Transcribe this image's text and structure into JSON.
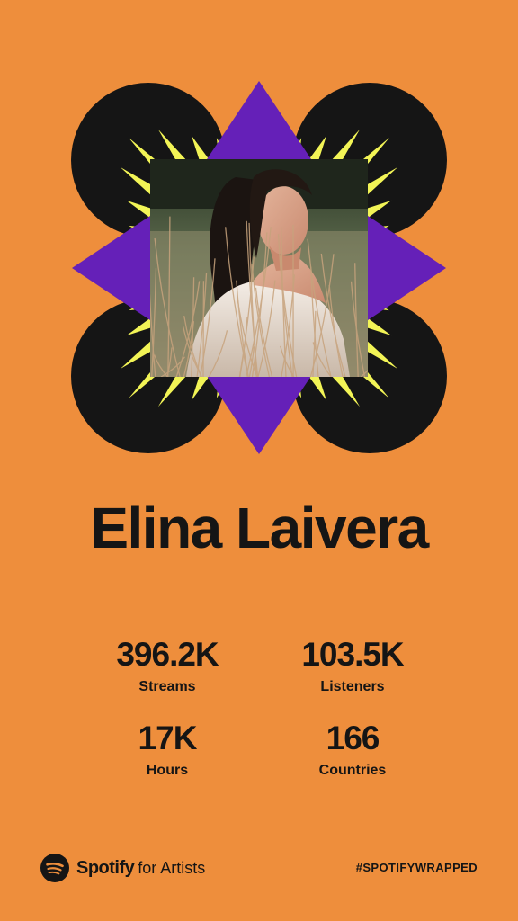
{
  "theme": {
    "background": "#EE8E3C",
    "black": "#151515",
    "yellow": "#F2F456",
    "purple": "#6520B8"
  },
  "cover": {
    "image_description": "artist-photo",
    "frame_icon": "starburst-frame"
  },
  "artist": {
    "name": "Elina Laivera"
  },
  "stats": [
    {
      "value": "396.2K",
      "label": "Streams"
    },
    {
      "value": "103.5K",
      "label": "Listeners"
    },
    {
      "value": "17K",
      "label": "Hours"
    },
    {
      "value": "166",
      "label": "Countries"
    }
  ],
  "footer": {
    "logo_icon": "spotify-icon",
    "brand": "Spotify",
    "brand_suffix": "for Artists",
    "hashtag": "#SPOTIFYWRAPPED"
  }
}
